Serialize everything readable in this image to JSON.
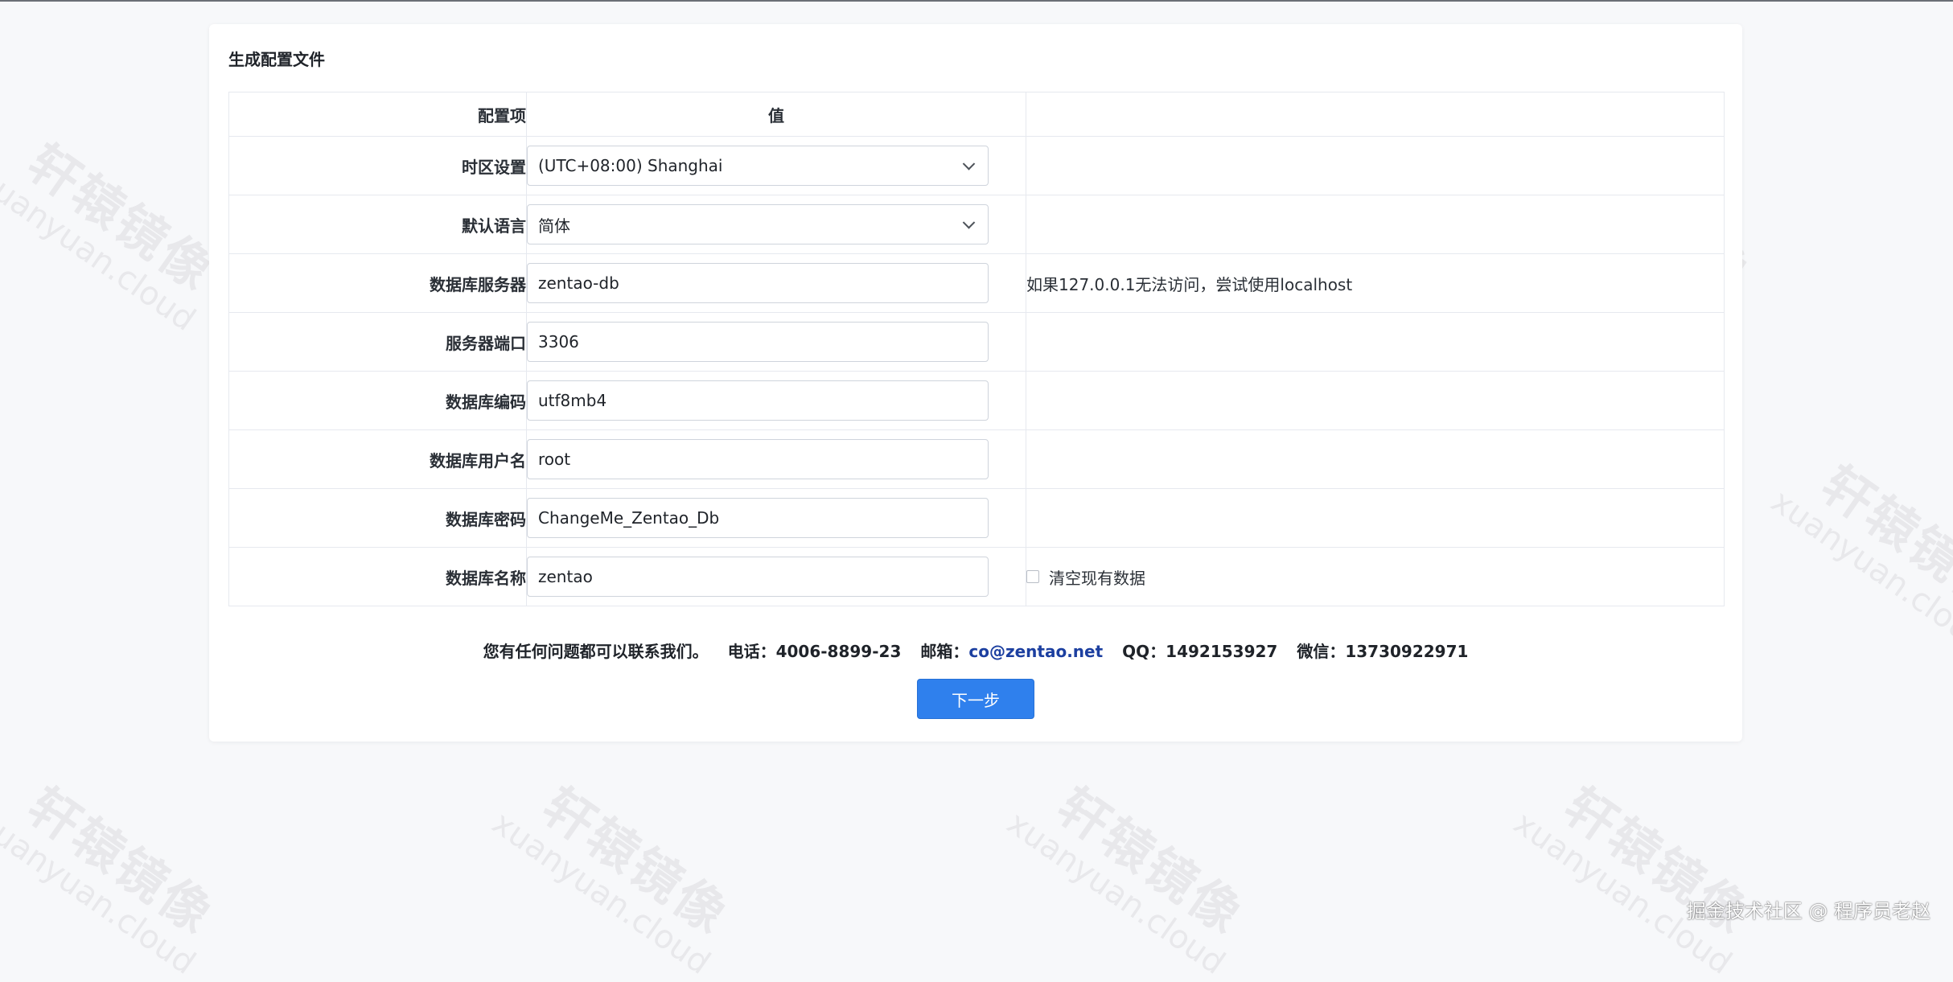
{
  "watermark": {
    "cn": "轩辕镜像",
    "en": "xuanyuan.cloud"
  },
  "card": {
    "title": "生成配置文件"
  },
  "table": {
    "headers": [
      "配置项",
      "值",
      ""
    ],
    "rows": [
      {
        "label": "时区设置",
        "value": "(UTC+08:00) Shanghai",
        "type": "select",
        "note": ""
      },
      {
        "label": "默认语言",
        "value": "简体",
        "type": "select",
        "note": ""
      },
      {
        "label": "数据库服务器",
        "value": "zentao-db",
        "type": "input",
        "note": "如果127.0.0.1无法访问，尝试使用localhost"
      },
      {
        "label": "服务器端口",
        "value": "3306",
        "type": "input",
        "note": ""
      },
      {
        "label": "数据库编码",
        "value": "utf8mb4",
        "type": "input",
        "note": ""
      },
      {
        "label": "数据库用户名",
        "value": "root",
        "type": "input",
        "note": ""
      },
      {
        "label": "数据库密码",
        "value": "ChangeMe_Zentao_Db",
        "type": "input",
        "note": ""
      },
      {
        "label": "数据库名称",
        "value": "zentao",
        "type": "input",
        "note": "",
        "checkbox_label": "清空现有数据"
      }
    ]
  },
  "contact": {
    "intro": "您有任何问题都可以联系我们。",
    "phone": "电话：4006-8899-23",
    "email_label": "邮箱：",
    "email": "co@zentao.net",
    "qq": "QQ：1492153927",
    "wechat": "微信：13730922971"
  },
  "buttons": {
    "next": "下一步"
  },
  "credit": "掘金技术社区 @ 程序员老赵",
  "colors": {
    "primary": "#2f80ed",
    "link": "#1c3fa0",
    "background": "#f7f8fa"
  }
}
